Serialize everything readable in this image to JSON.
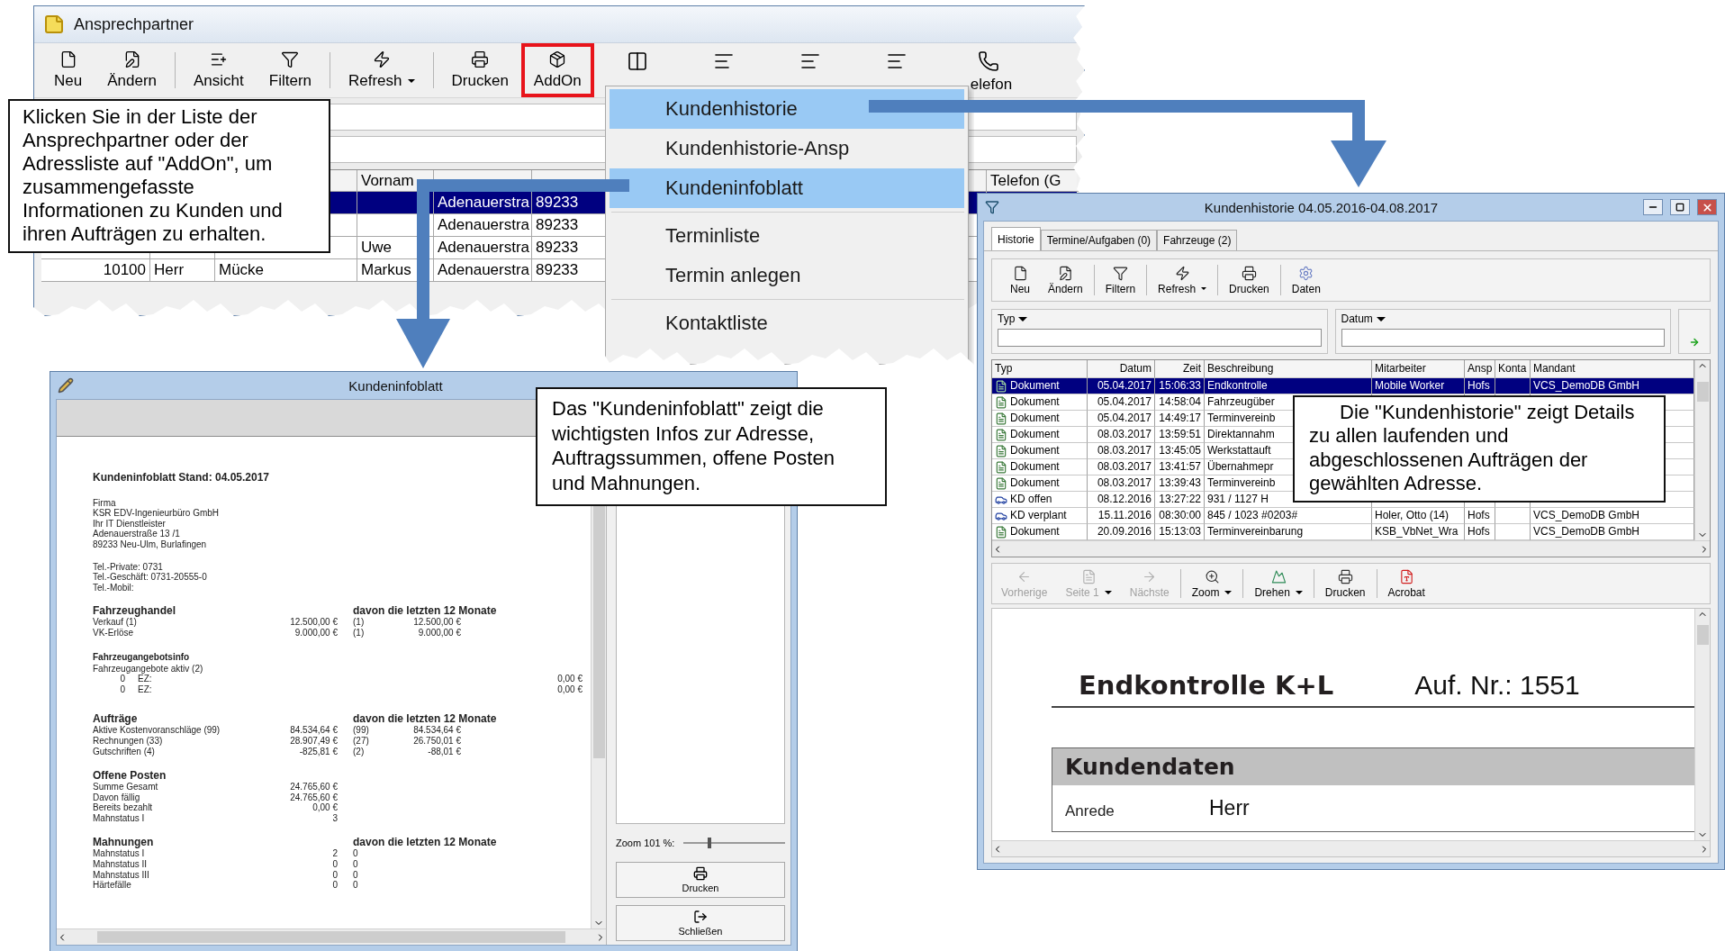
{
  "contacts_window": {
    "title": "Ansprechpartner",
    "toolbar": [
      {
        "kind": "button",
        "label": "Neu",
        "highlighted": false
      },
      {
        "kind": "button",
        "label": "Ändern",
        "highlighted": false
      },
      {
        "kind": "separator"
      },
      {
        "kind": "button",
        "label": "Ansicht",
        "highlighted": false
      },
      {
        "kind": "button",
        "label": "Filtern",
        "highlighted": false
      },
      {
        "kind": "separator"
      },
      {
        "kind": "split",
        "label": "Refresh",
        "highlighted": false
      },
      {
        "kind": "separator"
      },
      {
        "kind": "button",
        "label": "Drucken",
        "highlighted": false
      },
      {
        "kind": "button",
        "label": "AddOn",
        "highlighted": true
      },
      {
        "kind": "icon"
      },
      {
        "kind": "icon"
      },
      {
        "kind": "icon"
      },
      {
        "kind": "icon"
      },
      {
        "kind": "button",
        "label": "elefon",
        "highlighted": false
      }
    ],
    "table": {
      "columns": [
        null,
        null,
        null,
        "Vornam",
        null,
        null,
        null,
        "Telefon (G"
      ],
      "rows": [
        {
          "selected": true,
          "cells": [
            null,
            null,
            null,
            null,
            "Adenauerstra",
            "89233",
            null,
            null
          ]
        },
        {
          "selected": false,
          "cells": [
            null,
            null,
            null,
            null,
            "Adenauerstra",
            "89233",
            null,
            null
          ]
        },
        {
          "selected": false,
          "cells": [
            null,
            null,
            null,
            "Uwe",
            "Adenauerstra",
            "89233",
            null,
            null
          ]
        },
        {
          "selected": false,
          "cells": [
            "10100",
            "Herr",
            "Mücke",
            "Markus",
            "Adenauerstra",
            "89233",
            null,
            null
          ]
        }
      ]
    }
  },
  "addon_menu": {
    "items": [
      {
        "kind": "item",
        "label": "Kundenhistorie",
        "selected": true
      },
      {
        "kind": "item",
        "label": "Kundenhistorie-Ansp",
        "selected": false
      },
      {
        "kind": "item",
        "label": "Kundeninfoblatt",
        "selected": true
      },
      {
        "kind": "separator"
      },
      {
        "kind": "item",
        "label": "Terminliste",
        "selected": false
      },
      {
        "kind": "item",
        "label": "Termin anlegen",
        "selected": false
      },
      {
        "kind": "separator"
      },
      {
        "kind": "item",
        "label": "Kontaktliste",
        "selected": false
      }
    ]
  },
  "info_window": {
    "title": "Kundeninfoblatt",
    "report": {
      "heading": "Kundeninfoblatt Stand: 04.05.2017",
      "address": [
        "Firma",
        "KSR EDV-Ingenieurbüro GmbH",
        "Ihr IT Dienstleister",
        "Adenauerstraße 13 /1",
        "89233 Neu-Ulm, Burlafingen"
      ],
      "phones": [
        "Tel.-Private: 0731",
        "Tel.-Geschäft: 0731-20555-0",
        "Tel.-Mobil:"
      ],
      "sections": [
        {
          "kind": "major",
          "title": "Fahrzeughandel",
          "subtitle": "davon die letzten 12 Monate",
          "rows": [
            {
              "kind": "line",
              "label": "Verkauf (1)",
              "value": "12.500,00 €",
              "count": "(1)",
              "value2": "12.500,00 €"
            },
            {
              "kind": "line",
              "label": "VK-Erlöse",
              "value": "9.000,00 €",
              "count": "(1)",
              "value2": "9.000,00 €"
            }
          ]
        },
        {
          "kind": "minor",
          "title": "Fahrzeugangebotsinfo",
          "rows": [
            {
              "kind": "line",
              "label": "Fahrzeugangebote aktiv (2)"
            },
            {
              "kind": "offer",
              "count": "0",
              "label": "EZ:",
              "amount": "0,00 €"
            },
            {
              "kind": "offer",
              "count": "0",
              "label": "EZ:",
              "amount": "0,00 €"
            }
          ]
        },
        {
          "kind": "major",
          "title": "Aufträge",
          "subtitle": "davon die letzten 12 Monate",
          "rows": [
            {
              "kind": "line",
              "label": "Aktive Kostenvoranschläge (99)",
              "value": "84.534,64 €",
              "count": "(99)",
              "value2": "84.534,64 €"
            },
            {
              "kind": "line",
              "label": "Rechnungen (33)",
              "value": "28.907,49 €",
              "count": "(27)",
              "value2": "26.750,01 €"
            },
            {
              "kind": "line",
              "label": "Gutschriften (4)",
              "value": "-825,81 €",
              "count": "(2)",
              "value2": "-88,01 €"
            }
          ]
        },
        {
          "kind": "major",
          "title": "Offene Posten",
          "rows": [
            {
              "kind": "line",
              "label": "Summe Gesamt",
              "value": "24.765,60 €"
            },
            {
              "kind": "line",
              "label": "Davon fällig",
              "value": "24.765,60 €"
            },
            {
              "kind": "line",
              "label": "Bereits bezahlt",
              "value": "0,00 €"
            },
            {
              "kind": "line",
              "label": "Mahnstatus I",
              "value": "3"
            }
          ]
        },
        {
          "kind": "major",
          "title": "Mahnungen",
          "subtitle": "davon die letzten 12 Monate",
          "rows": [
            {
              "kind": "line",
              "label": "Mahnstatus I",
              "value": "2",
              "count": "0"
            },
            {
              "kind": "line",
              "label": "Mahnstatus II",
              "value": "0",
              "count": "0"
            },
            {
              "kind": "line",
              "label": "Mahnstatus III",
              "value": "0",
              "count": "0"
            },
            {
              "kind": "line",
              "label": "Härtefälle",
              "value": "0",
              "count": "0"
            }
          ]
        }
      ]
    },
    "zoom": {
      "label": "Zoom 101 %:",
      "level": 0.25
    },
    "buttons": [
      "Drucken",
      "Schließen"
    ]
  },
  "history_window": {
    "title": "Kundenhistorie 04.05.2016-04.08.2017",
    "tabs": [
      {
        "label": "Historie",
        "selected": true
      },
      {
        "label": "Termine/Aufgaben (0)",
        "selected": false
      },
      {
        "label": "Fahrzeuge (2)",
        "selected": false
      }
    ],
    "toolbar": [
      {
        "kind": "button",
        "label": "Neu"
      },
      {
        "kind": "button",
        "label": "Ändern"
      },
      {
        "kind": "separator"
      },
      {
        "kind": "button",
        "label": "Filtern"
      },
      {
        "kind": "separator"
      },
      {
        "kind": "split",
        "label": "Refresh"
      },
      {
        "kind": "separator"
      },
      {
        "kind": "button",
        "label": "Drucken"
      },
      {
        "kind": "separator"
      },
      {
        "kind": "button",
        "label": "Daten"
      }
    ],
    "filters": [
      "Typ",
      "Datum"
    ],
    "table": {
      "columns": [
        "Typ",
        "Datum",
        "Zeit",
        "Beschreibung",
        "Mitarbeiter",
        "Ansp",
        "Konta",
        "Mandant"
      ],
      "rows": [
        {
          "kind": "dokument",
          "selected": true,
          "cells": [
            "Dokument",
            "05.04.2017",
            "15:06:33",
            "Endkontrolle",
            "Mobile Worker",
            "Hofs",
            null,
            "VCS_DemoDB GmbH"
          ]
        },
        {
          "kind": "dokument",
          "selected": false,
          "cells": [
            "Dokument",
            "05.04.2017",
            "14:58:04",
            "Fahrzeugüber",
            null,
            null,
            null,
            null
          ]
        },
        {
          "kind": "dokument",
          "selected": false,
          "cells": [
            "Dokument",
            "05.04.2017",
            "14:49:17",
            "Terminvereinb",
            null,
            null,
            null,
            null
          ]
        },
        {
          "kind": "dokument",
          "selected": false,
          "cells": [
            "Dokument",
            "08.03.2017",
            "13:59:51",
            "Direktannahm",
            null,
            null,
            null,
            null
          ]
        },
        {
          "kind": "dokument",
          "selected": false,
          "cells": [
            "Dokument",
            "08.03.2017",
            "13:45:05",
            "Werkstattauft",
            null,
            null,
            null,
            null
          ]
        },
        {
          "kind": "dokument",
          "selected": false,
          "cells": [
            "Dokument",
            "08.03.2017",
            "13:41:57",
            "Übernahmepr",
            null,
            null,
            null,
            null
          ]
        },
        {
          "kind": "dokument",
          "selected": false,
          "cells": [
            "Dokument",
            "08.03.2017",
            "13:39:43",
            "Terminvereinb",
            null,
            null,
            null,
            null
          ]
        },
        {
          "kind": "kd",
          "selected": false,
          "cells": [
            "KD offen",
            "08.12.2016",
            "13:27:22",
            "931 / 1127 H",
            null,
            null,
            null,
            null
          ]
        },
        {
          "kind": "kd",
          "selected": false,
          "cells": [
            "KD verplant",
            "15.11.2016",
            "08:30:00",
            "845 / 1023 #0203#",
            "Holer, Otto (14)",
            "Hofs",
            null,
            "VCS_DemoDB GmbH"
          ]
        },
        {
          "kind": "dokument",
          "selected": false,
          "cells": [
            "Dokument",
            "20.09.2016",
            "15:13:03",
            "Terminvereinbarung",
            "KSB_VbNet_Wra",
            "Hofs",
            null,
            "VCS_DemoDB GmbH"
          ]
        }
      ]
    },
    "viewer_toolbar": [
      {
        "kind": "button",
        "label": "Vorherige",
        "disabled": true
      },
      {
        "kind": "split",
        "label": "Seite 1",
        "disabled": true
      },
      {
        "kind": "button",
        "label": "Nächste",
        "disabled": true
      },
      {
        "kind": "separator"
      },
      {
        "kind": "split",
        "label": "Zoom",
        "disabled": false
      },
      {
        "kind": "separator"
      },
      {
        "kind": "split",
        "label": "Drehen",
        "disabled": false
      },
      {
        "kind": "separator"
      },
      {
        "kind": "button",
        "label": "Drucken",
        "disabled": false
      },
      {
        "kind": "separator"
      },
      {
        "kind": "button",
        "label": "Acrobat",
        "disabled": false
      }
    ],
    "document": {
      "title": "Endkontrolle K+L",
      "order_no": "Auf. Nr.: 1551",
      "section": "Kundendaten",
      "fields": [
        {
          "label": "Anrede",
          "value": "Herr"
        }
      ]
    }
  },
  "callouts": [
    "Klicken Sie in der Liste der Ansprechpartner oder der Adressliste auf \"AddOn\", um zusammengefasste Informationen zu Kunden und ihren Aufträgen zu erhalten.",
    "Das \"Kundeninfoblatt\" zeigt die wichtigsten Infos zur Adresse, Auftragssummen, offene Posten und Mahnungen.",
    "Die \"Kundenhistorie\" zeigt Details zu allen laufenden und abgeschlossenen Aufträgen der gewählten Adresse."
  ]
}
